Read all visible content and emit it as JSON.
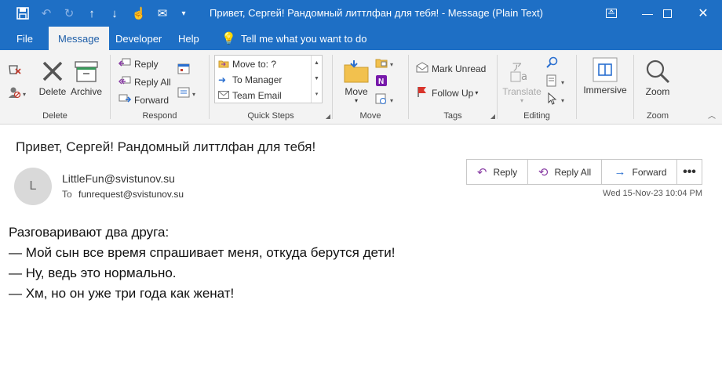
{
  "window": {
    "title": "Привет, Сергей! Рандомный литтлфан для тебя!  -  Message (Plain Text)",
    "qat_icons": [
      "save-icon",
      "undo-icon",
      "redo-icon",
      "up-arrow-icon",
      "down-arrow-icon",
      "touch-mode-icon",
      "move-to-folder-icon",
      "customize-qat-icon"
    ]
  },
  "menu": {
    "tabs": [
      "File",
      "Message",
      "Developer",
      "Help"
    ],
    "active": "Message",
    "tell_me": "Tell me what you want to do"
  },
  "ribbon": {
    "delete_group": {
      "label": "Delete",
      "delete": "Delete",
      "archive": "Archive"
    },
    "respond_group": {
      "label": "Respond",
      "reply": "Reply",
      "reply_all": "Reply All",
      "forward": "Forward"
    },
    "quicksteps_group": {
      "label": "Quick Steps",
      "items": [
        "Move to: ?",
        "To Manager",
        "Team Email"
      ]
    },
    "move_group": {
      "label": "Move",
      "move": "Move"
    },
    "tags_group": {
      "label": "Tags",
      "mark_unread": "Mark Unread",
      "follow_up": "Follow Up"
    },
    "editing_group": {
      "label": "Editing",
      "translate": "Translate"
    },
    "immersive_group": {
      "immersive": "Immersive"
    },
    "zoom_group": {
      "label": "Zoom",
      "zoom": "Zoom"
    }
  },
  "message": {
    "subject": "Привет, Сергей! Рандомный литтлфан для тебя!",
    "avatar_initial": "L",
    "from": "LittleFun@svistunov.su",
    "to_label": "To",
    "to": "funrequest@svistunov.su",
    "date": "Wed 15-Nov-23 10:04 PM",
    "actions": {
      "reply": "Reply",
      "reply_all": "Reply All",
      "forward": "Forward",
      "more": "•••"
    },
    "body_lines": [
      "Разговаривают два друга:",
      "— Мой сын все время спрашивает меня, откуда берутся дети!",
      "— Ну, ведь это нормально.",
      "— Хм, но он уже три года как женат!"
    ]
  },
  "colors": {
    "titlebar": "#1e6fc5",
    "ribbon": "#f3f3f3",
    "accent_purple": "#8a3fa5",
    "accent_blue": "#2a6fd0"
  }
}
